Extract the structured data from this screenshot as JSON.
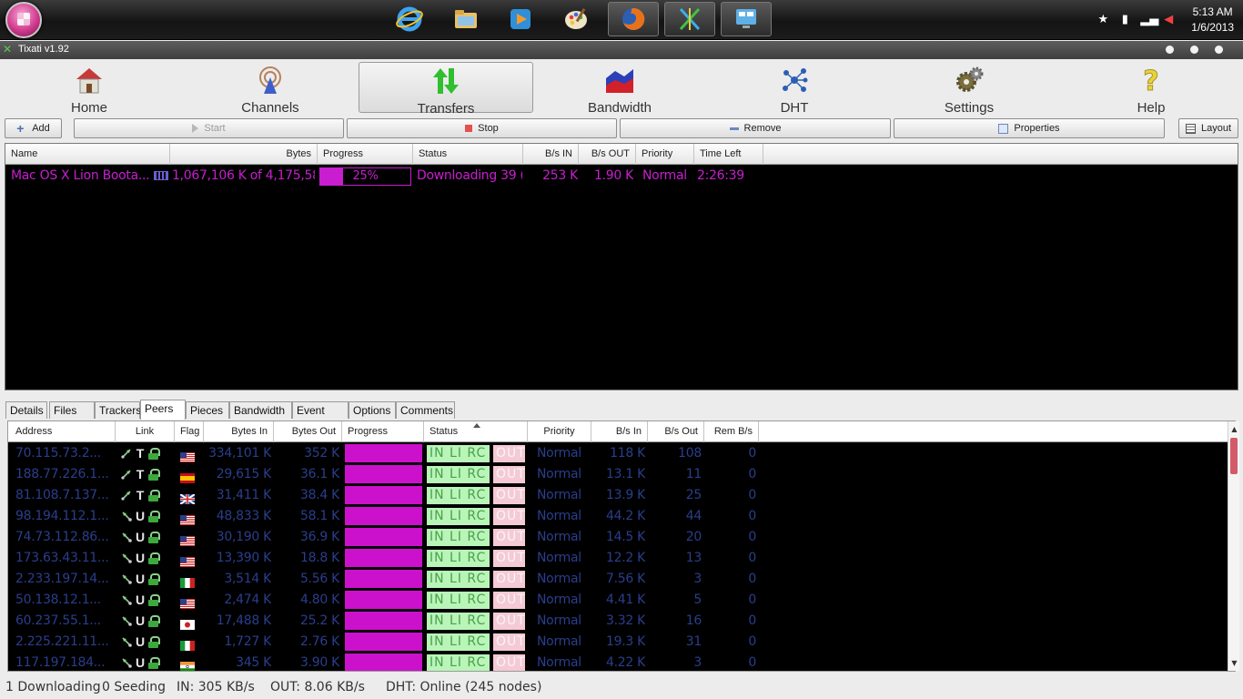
{
  "taskbar": {
    "apps": [
      "internet-explorer",
      "windows-explorer",
      "media-player",
      "paint",
      "firefox",
      "tixati",
      "control-panel"
    ],
    "time": "5:13 AM",
    "date": "1/6/2013"
  },
  "window": {
    "title": "Tixati v1.92"
  },
  "toolbar": {
    "home": "Home",
    "channels": "Channels",
    "transfers": "Transfers",
    "bandwidth": "Bandwidth",
    "dht": "DHT",
    "settings": "Settings",
    "help": "Help"
  },
  "actions": {
    "add": "Add",
    "start": "Start",
    "stop": "Stop",
    "remove": "Remove",
    "properties": "Properties",
    "layout": "Layout"
  },
  "transfers": {
    "columns": {
      "name": "Name",
      "bytes": "Bytes",
      "progress": "Progress",
      "status": "Status",
      "bs_in": "B/s IN",
      "bs_out": "B/s OUT",
      "priority": "Priority",
      "time_left": "Time Left"
    },
    "rows": [
      {
        "name": "Mac OS X Lion Boota...",
        "bytes": "1,067,106 K of 4,175,58",
        "progress_label": "25%",
        "progress": 0.25,
        "status": "Downloading 39 (",
        "bs_in": "253 K",
        "bs_out": "1.90 K",
        "priority": "Normal",
        "time_left": "2:26:39"
      }
    ]
  },
  "tabs": [
    "Details",
    "Files",
    "Trackers",
    "Peers",
    "Pieces",
    "Bandwidth",
    "Event Log",
    "Options",
    "Comments"
  ],
  "active_tab": "Peers",
  "peers": {
    "columns": {
      "address": "Address",
      "link": "Link",
      "flag": "Flag",
      "bytes_in": "Bytes In",
      "bytes_out": "Bytes Out",
      "progress": "Progress",
      "status": "Status",
      "priority": "Priority",
      "bs_in": "B/s In",
      "bs_out": "B/s Out",
      "rem_bs": "Rem B/s"
    },
    "status_labels": {
      "in": "IN",
      "li": "LI",
      "rc": "RC",
      "out": "OUT"
    },
    "rows": [
      {
        "address": "70.115.73.2...",
        "dir": "T",
        "flag": "us",
        "bytes_in": "334,101 K",
        "bytes_out": "352 K",
        "priority": "Normal",
        "bs_in": "118 K",
        "bs_out": "108",
        "rem": "0"
      },
      {
        "address": "188.77.226.1...",
        "dir": "T",
        "flag": "es",
        "bytes_in": "29,615 K",
        "bytes_out": "36.1 K",
        "priority": "Normal",
        "bs_in": "13.1 K",
        "bs_out": "11",
        "rem": "0"
      },
      {
        "address": "81.108.7.137...",
        "dir": "T",
        "flag": "gb",
        "bytes_in": "31,411 K",
        "bytes_out": "38.4 K",
        "priority": "Normal",
        "bs_in": "13.9 K",
        "bs_out": "25",
        "rem": "0"
      },
      {
        "address": "98.194.112.1...",
        "dir": "U",
        "flag": "us",
        "bytes_in": "48,833 K",
        "bytes_out": "58.1 K",
        "priority": "Normal",
        "bs_in": "44.2 K",
        "bs_out": "44",
        "rem": "0"
      },
      {
        "address": "74.73.112.86...",
        "dir": "U",
        "flag": "us",
        "bytes_in": "30,190 K",
        "bytes_out": "36.9 K",
        "priority": "Normal",
        "bs_in": "14.5 K",
        "bs_out": "20",
        "rem": "0"
      },
      {
        "address": "173.63.43.11...",
        "dir": "U",
        "flag": "us",
        "bytes_in": "13,390 K",
        "bytes_out": "18.8 K",
        "priority": "Normal",
        "bs_in": "12.2 K",
        "bs_out": "13",
        "rem": "0"
      },
      {
        "address": "2.233.197.14...",
        "dir": "U",
        "flag": "it",
        "bytes_in": "3,514 K",
        "bytes_out": "5.56 K",
        "priority": "Normal",
        "bs_in": "7.56 K",
        "bs_out": "3",
        "rem": "0"
      },
      {
        "address": "50.138.12.1...",
        "dir": "U",
        "flag": "us",
        "bytes_in": "2,474 K",
        "bytes_out": "4.80 K",
        "priority": "Normal",
        "bs_in": "4.41 K",
        "bs_out": "5",
        "rem": "0"
      },
      {
        "address": "60.237.55.1...",
        "dir": "U",
        "flag": "jp",
        "bytes_in": "17,488 K",
        "bytes_out": "25.2 K",
        "priority": "Normal",
        "bs_in": "3.32 K",
        "bs_out": "16",
        "rem": "0"
      },
      {
        "address": "2.225.221.11...",
        "dir": "U",
        "flag": "it",
        "bytes_in": "1,727 K",
        "bytes_out": "2.76 K",
        "priority": "Normal",
        "bs_in": "19.3 K",
        "bs_out": "31",
        "rem": "0"
      },
      {
        "address": "117.197.184...",
        "dir": "U",
        "flag": "in",
        "bytes_in": "345 K",
        "bytes_out": "3.90 K",
        "priority": "Normal",
        "bs_in": "4.22 K",
        "bs_out": "3",
        "rem": "0"
      }
    ]
  },
  "statusbar": {
    "downloading": "1 Downloading",
    "seeding": "0 Seeding",
    "in": "IN: 305 KB/s",
    "out": "OUT: 8.06 KB/s",
    "dht": "DHT: Online (245 nodes)"
  },
  "colors": {
    "accent": "#cc11cc",
    "peer_text": "#2a3e8c",
    "status_in_bg": "#b9f5b9",
    "status_out_bg": "#f6c9d6"
  }
}
